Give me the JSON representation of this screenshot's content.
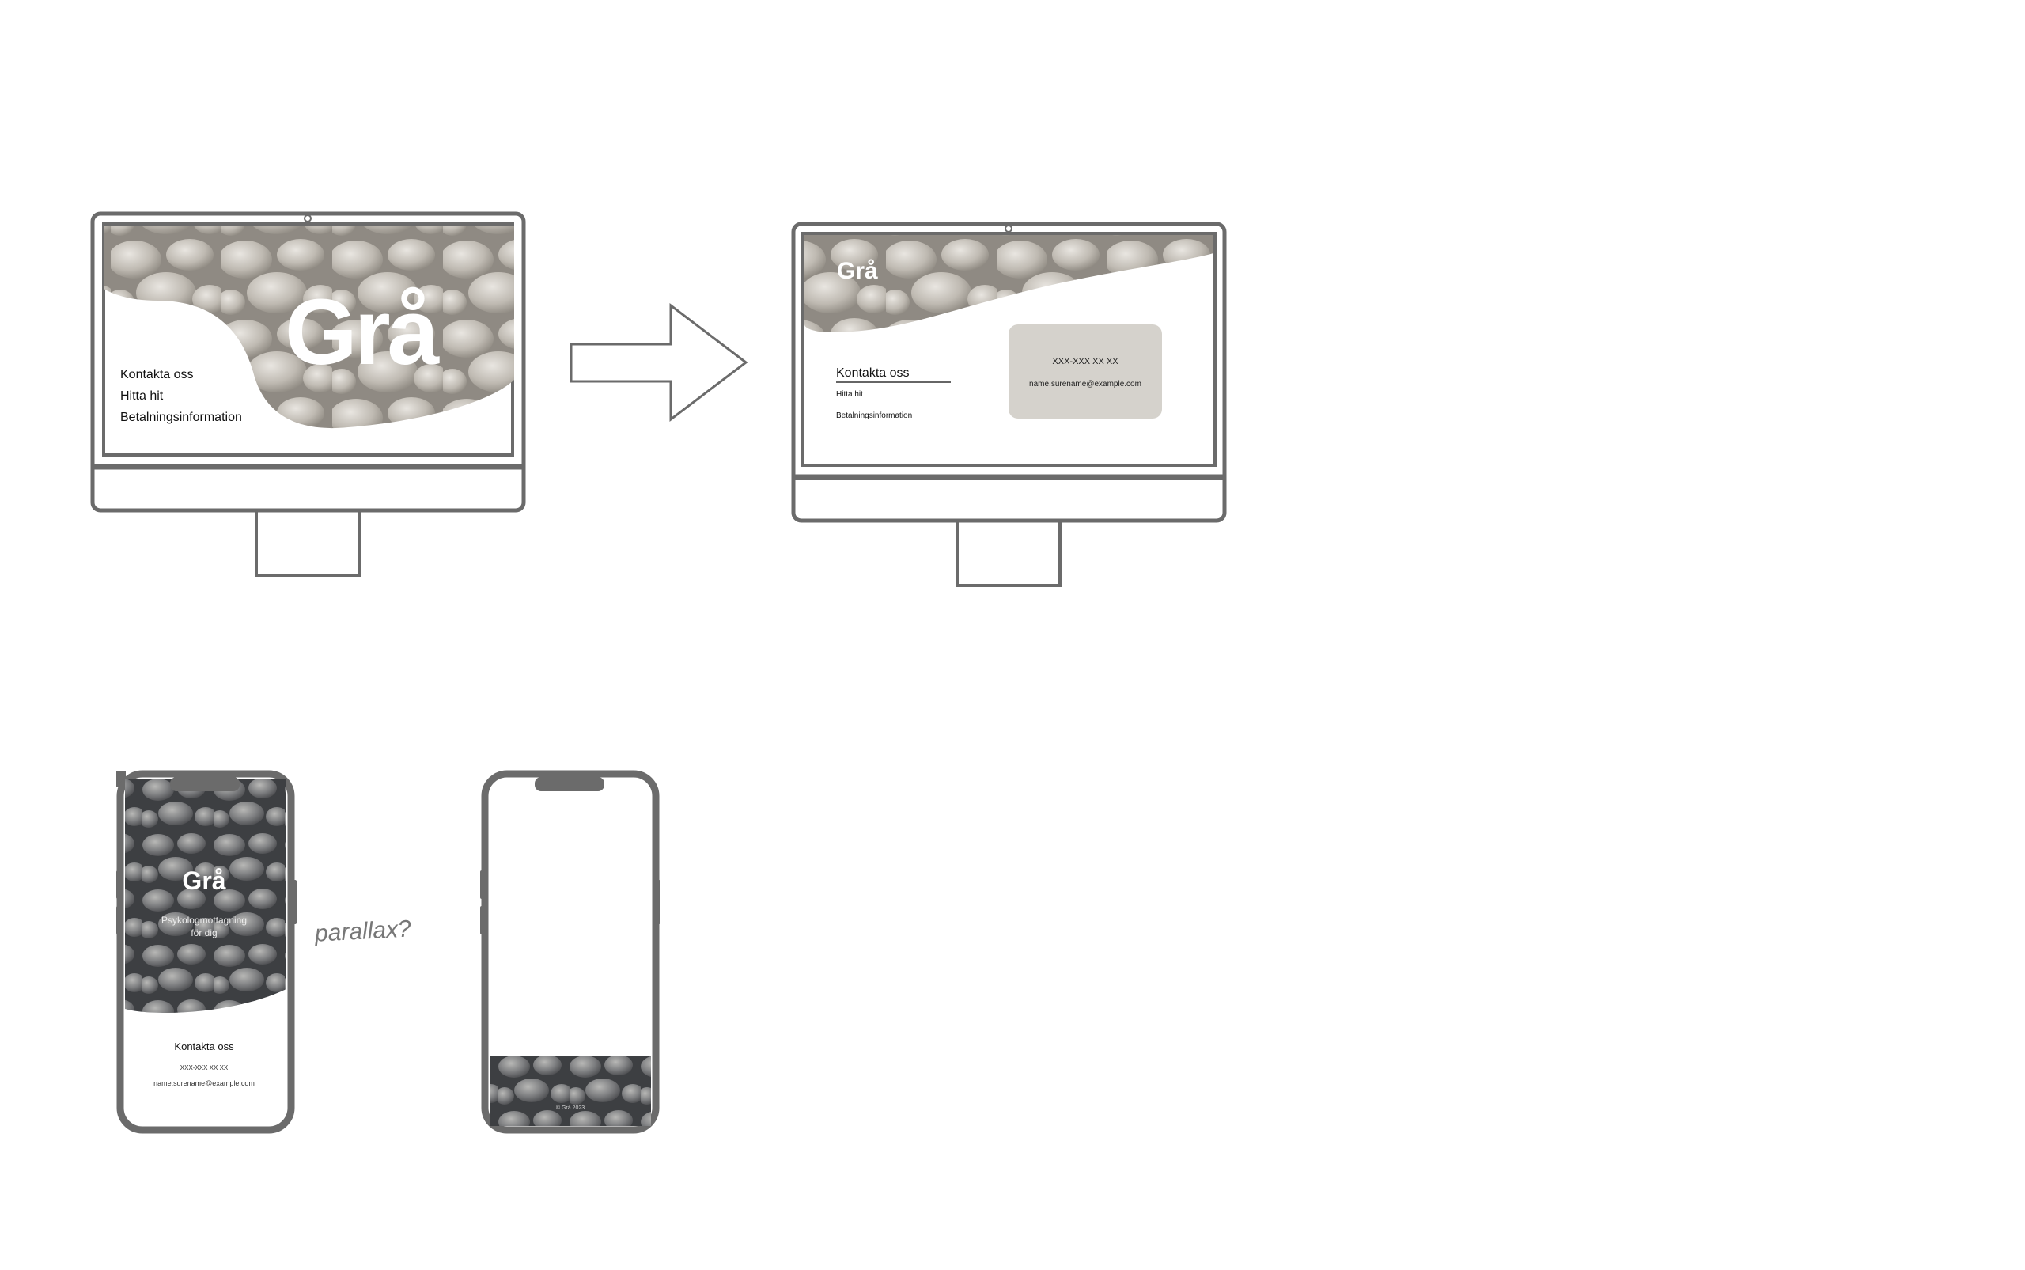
{
  "desktop_a": {
    "logo": "Grå",
    "menu": [
      "Kontakta oss",
      "Hitta hit",
      "Betalningsinformation"
    ]
  },
  "desktop_b": {
    "logo": "Grå",
    "menu_heading": "Kontakta oss",
    "menu": [
      "Hitta hit",
      "Betalningsinformation"
    ],
    "contact_card": {
      "phone": "XXX-XXX XX XX",
      "email": "name.surename@example.com"
    }
  },
  "phone_a": {
    "logo": "Grå",
    "tagline": "Psykologmottagning för dig",
    "contact_heading": "Kontakta oss",
    "phone": "XXX-XXX XX XX",
    "email": "name.surename@example.com"
  },
  "phone_b": {
    "footer_text": "© Grå 2023"
  },
  "annotation": {
    "handwritten_note": "parallax?"
  },
  "colors": {
    "device_frame": "#6b6b6b",
    "contact_card_bg": "#d5d2cc",
    "stone_mid": "#9c978f",
    "background": "#ffffff"
  },
  "icons": {
    "transition_arrow": "right-arrow-outline"
  }
}
